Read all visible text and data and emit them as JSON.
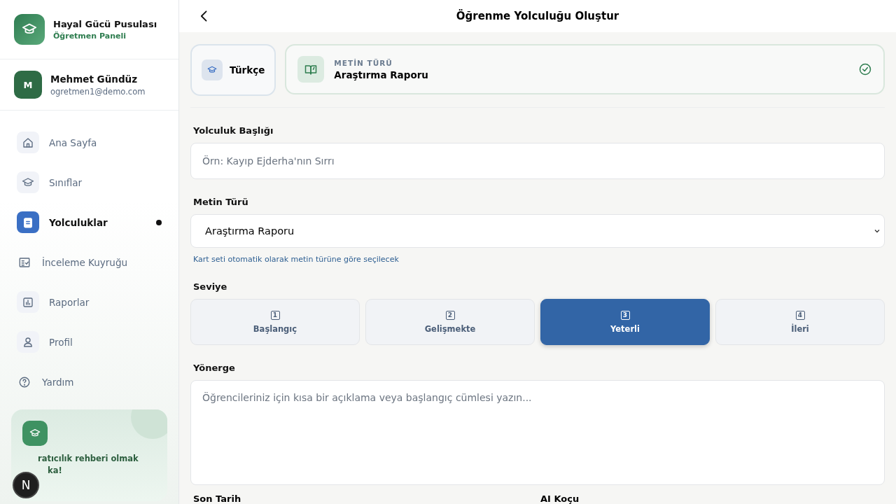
{
  "brand": {
    "title": "Hayal Gücü Pusulası",
    "subtitle": "Öğretmen Paneli"
  },
  "user": {
    "initial": "M",
    "name": "Mehmet Gündüz",
    "email": "ogretmen1@demo.com"
  },
  "nav": [
    {
      "label": "Ana Sayfa",
      "selected": false
    },
    {
      "label": "Sınıflar",
      "selected": false
    },
    {
      "label": "Yolculuklar",
      "selected": true
    },
    {
      "label": "İnceleme Kuyruğu",
      "selected": false
    },
    {
      "label": "Raporlar",
      "selected": false
    },
    {
      "label": "Profil",
      "selected": false
    },
    {
      "label": "Yardım",
      "selected": false
    }
  ],
  "promo": {
    "lines": [
      "ratıcılık rehberi olmak",
      "ka!"
    ]
  },
  "dev_badge": "N",
  "header": {
    "title": "Öğrenme Yolculuğu Oluştur"
  },
  "subject": {
    "label": "Türkçe"
  },
  "text_type_card": {
    "caption": "METİN TÜRÜ",
    "value": "Araştırma Raporu",
    "done": true
  },
  "title_field": {
    "label": "Yolculuk Başlığı",
    "placeholder": "Örn: Kayıp Ejderha'nın Sırrı"
  },
  "type_select": {
    "label": "Metin Türü",
    "value": "Araştırma Raporu",
    "hint": "Kart seti otomatik olarak metin türüne göre seçilecek"
  },
  "levels": {
    "label": "Seviye",
    "items": [
      {
        "number": "1",
        "label": "Başlangıç",
        "selected": false
      },
      {
        "number": "2",
        "label": "Gelişmekte",
        "selected": false
      },
      {
        "number": "3",
        "label": "Yeterli",
        "selected": true
      },
      {
        "number": "4",
        "label": "İleri",
        "selected": false
      }
    ]
  },
  "instruction": {
    "label": "Yönerge",
    "placeholder": "Öğrencileriniz için kısa bir açıklama veya başlangıç cümlesi yazın..."
  },
  "bottom_labels": [
    "Son Tarih",
    "AI Koçu"
  ]
}
